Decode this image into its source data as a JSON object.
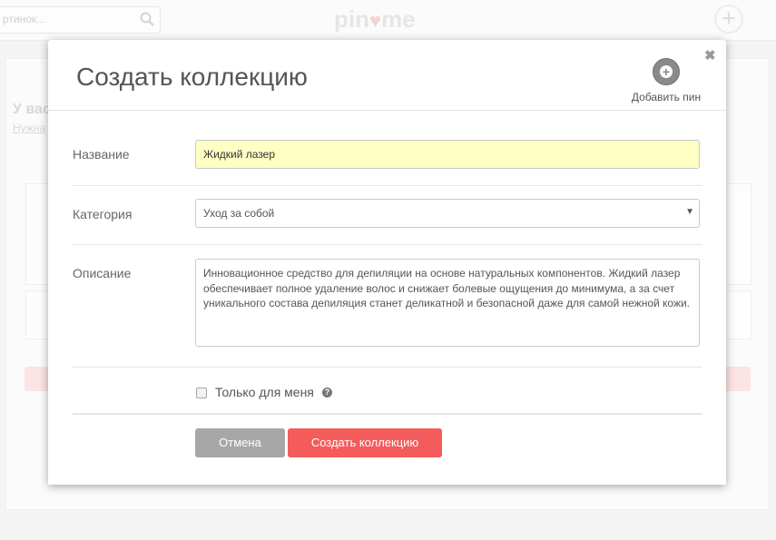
{
  "background": {
    "search_placeholder": "ртинок...",
    "logo_left": "pin",
    "logo_heart": "♥",
    "logo_right": "me",
    "add_symbol": "+",
    "title_fragment": "У вас",
    "link_fragment": "Нужна"
  },
  "modal": {
    "title": "Создать коллекцию",
    "add_pin_label": "Добавить пин",
    "add_pin_icon": "plus-circle-icon",
    "close_symbol": "✖",
    "fields": {
      "name_label": "Название",
      "name_value": "Жидкий лазер",
      "category_label": "Категория",
      "category_value": "Уход за собой",
      "description_label": "Описание",
      "description_value": "Инновационное средство для депиляции на основе натуральных компонентов. Жидкий лазер обеспечивает полное удаление волос и снижает болевые ощущения до минимума, а за счет уникального состава депиляция станет деликатной и безопасной даже для самой нежной кожи."
    },
    "private_label": "Только для меня",
    "private_checked": false,
    "help_symbol": "?",
    "buttons": {
      "cancel": "Отмена",
      "create": "Создать коллекцию"
    }
  },
  "colors": {
    "accent": "#f45c5c",
    "cancel": "#a7a7a7",
    "highlight_input": "#ffffc4"
  }
}
